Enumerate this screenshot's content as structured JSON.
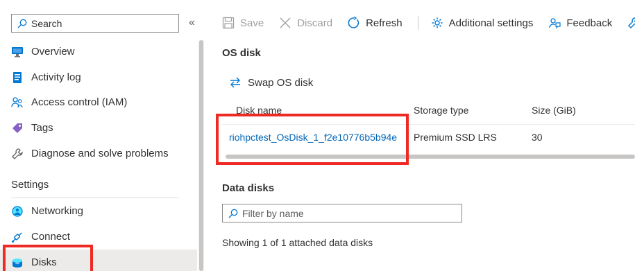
{
  "sidebar": {
    "search_placeholder": "Search",
    "collapse_glyph": "«",
    "items": [
      {
        "label": "Overview",
        "icon": "overview-icon"
      },
      {
        "label": "Activity log",
        "icon": "activity-log-icon"
      },
      {
        "label": "Access control (IAM)",
        "icon": "access-control-icon"
      },
      {
        "label": "Tags",
        "icon": "tag-icon"
      },
      {
        "label": "Diagnose and solve problems",
        "icon": "wrench-icon"
      }
    ],
    "section_label": "Settings",
    "settings_items": [
      {
        "label": "Networking",
        "icon": "networking-icon"
      },
      {
        "label": "Connect",
        "icon": "connect-icon"
      },
      {
        "label": "Disks",
        "icon": "disks-icon",
        "selected": true
      }
    ]
  },
  "toolbar": {
    "save_label": "Save",
    "discard_label": "Discard",
    "refresh_label": "Refresh",
    "additional_settings_label": "Additional settings",
    "feedback_label": "Feedback"
  },
  "os_disk": {
    "title": "OS disk",
    "swap_label": "Swap OS disk",
    "columns": [
      "Disk name",
      "Storage type",
      "Size (GiB)"
    ],
    "row": {
      "disk_name": "riohpctest_OsDisk_1_f2e10776b5b94e",
      "storage_type": "Premium SSD LRS",
      "size": "30"
    }
  },
  "data_disks": {
    "title": "Data disks",
    "filter_placeholder": "Filter by name",
    "summary": "Showing 1 of 1 attached data disks"
  },
  "colors": {
    "accent": "#0078d4",
    "link": "#0066b8",
    "highlight": "#ee2a24",
    "selected_bg": "#edebe9"
  }
}
